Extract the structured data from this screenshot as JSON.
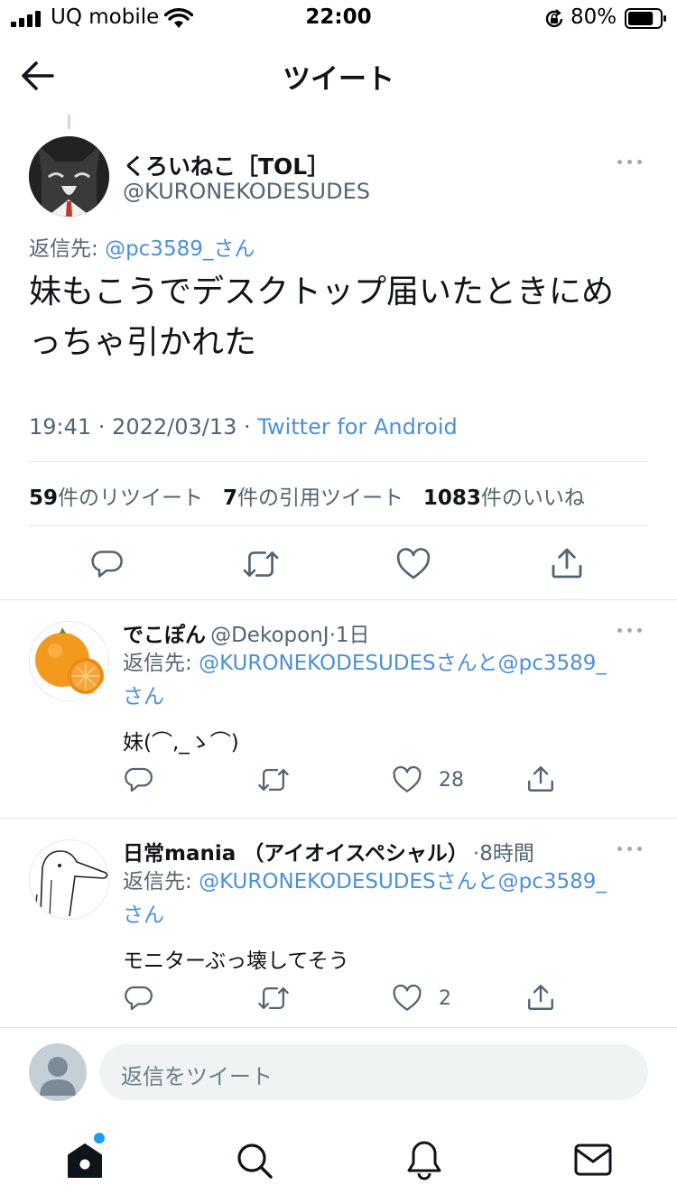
{
  "status_bar": {
    "carrier": "UQ mobile",
    "time": "22:00",
    "battery": "80%",
    "battery_level": 0.8
  },
  "header": {
    "title": "ツイート",
    "back_icon": "arrow-left-icon"
  },
  "main_tweet": {
    "display_name": "くろいねこ［TOL］",
    "handle": "@KURONEKODESUDES",
    "reply_label": "返信先:",
    "reply_target": "@pc3589_さん",
    "text_line1": "妹もこうでデスクトップ届いたときにめ",
    "text_line2": "っちゃ引かれた",
    "timestamp": "19:41 · 2022/03/13 · ",
    "source": "Twitter for Android",
    "retweets_count": "59",
    "retweets_label": "件のリツイート",
    "quotes_count": "7",
    "quotes_label": "件の引用ツイート",
    "likes_count": "1083",
    "likes_label": "件のいいね"
  },
  "replies": [
    {
      "name": "でこぽん",
      "handle": "@DekoponJ",
      "time": "1日",
      "reply_label": "返信先:",
      "reply_targets_line1": "@KURONEKODESUDESさんと@pc3589_",
      "reply_targets_line2": "さん",
      "text": "妹(⌒,_ゝ⌒)",
      "likes": "28"
    },
    {
      "name": "日常mania （アイオイスペシャル）",
      "handle": "",
      "time": "8時間",
      "reply_label": "返信先:",
      "reply_targets_line1": "@KURONEKODESUDESさんと@pc3589_",
      "reply_targets_line2": "さん",
      "text": "モニターぶっ壊してそう",
      "likes": "2"
    }
  ],
  "compose": {
    "placeholder": "返信をツイート"
  },
  "tab_bar": {
    "items": [
      "home-icon",
      "search-icon",
      "bell-icon",
      "mail-icon"
    ]
  },
  "colors": {
    "link": "#4a90d9",
    "secondary_text": "#536471",
    "notification_dot": "#1d9bf0"
  }
}
